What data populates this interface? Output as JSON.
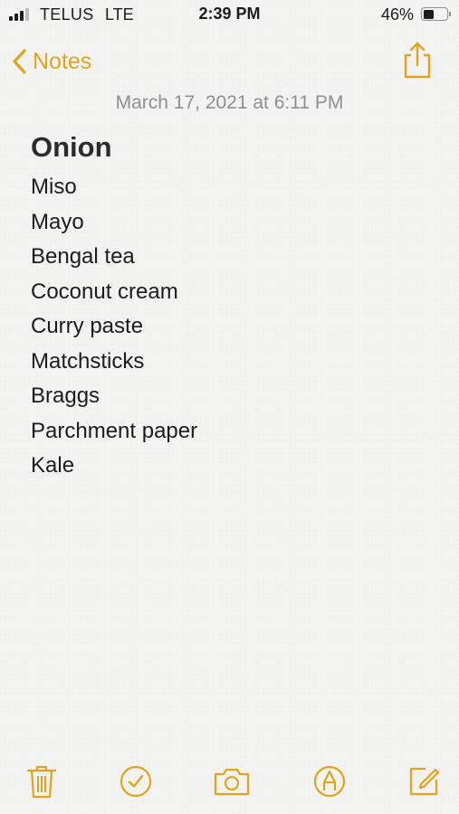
{
  "status_bar": {
    "carrier": "TELUS",
    "network": "LTE",
    "time": "2:39 PM",
    "battery_percent": "46%",
    "battery_level": 0.46,
    "signal_bars": 3
  },
  "nav": {
    "back_label": "Notes",
    "back_icon": "chevron-left-icon",
    "share_icon": "share-icon"
  },
  "note": {
    "date": "March 17, 2021 at 6:11 PM",
    "title": "Onion",
    "lines": [
      "Miso",
      "Mayo",
      "Bengal tea",
      "Coconut cream",
      "Curry paste",
      "Matchsticks",
      "Braggs",
      "Parchment paper",
      "Kale"
    ]
  },
  "toolbar": {
    "items": [
      "trash-icon",
      "checklist-icon",
      "camera-icon",
      "markup-icon",
      "compose-icon"
    ]
  },
  "colors": {
    "accent": "#e0a421",
    "background": "#f3f3f1",
    "date_text": "#8e8e93"
  }
}
